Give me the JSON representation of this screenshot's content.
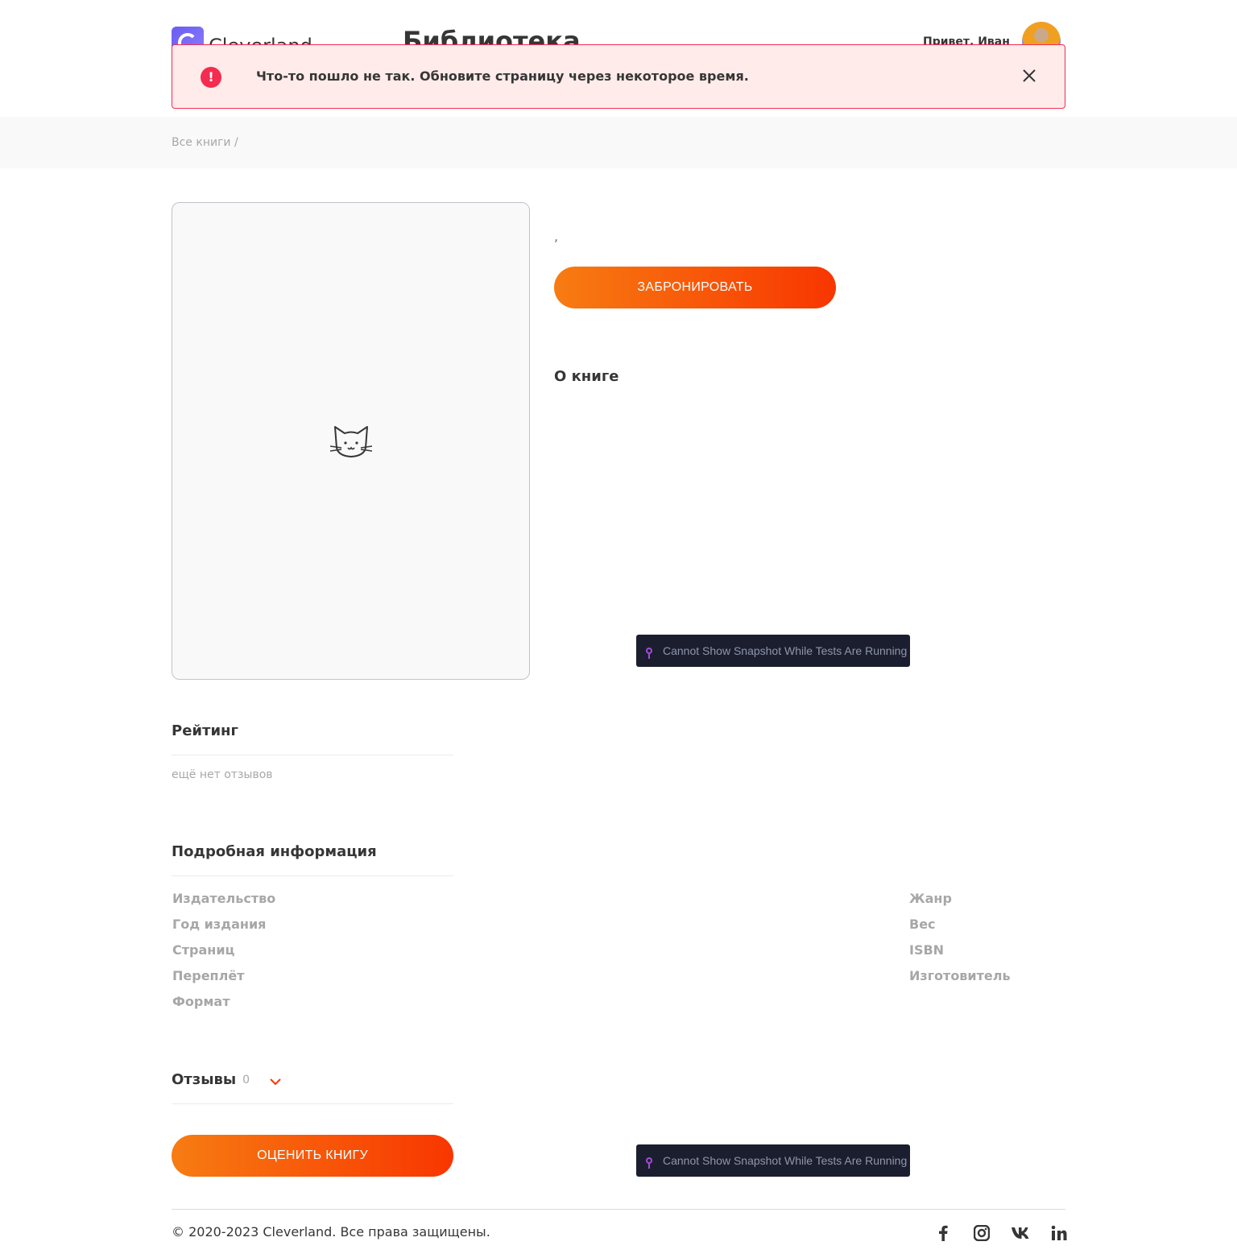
{
  "header": {
    "logo_text": "Cleverland",
    "page_title": "Библиотека",
    "greeting": "Привет, Иван"
  },
  "toast": {
    "icon_text": "!",
    "message": "Что-то пошло не так. Обновите страницу через некоторое время.",
    "status_color": "#f42c4f"
  },
  "breadcrumbs": {
    "text": "Все книги /"
  },
  "book": {
    "meta": ",",
    "reserve_label": "ЗАБРОНИРОВАТЬ",
    "about_title": "О книге"
  },
  "rating": {
    "title": "Рейтинг",
    "empty_text": "ещё нет отзывов"
  },
  "details": {
    "title": "Подробная информация",
    "left": [
      "Издательство",
      "Год издания",
      "Страниц",
      "Переплёт",
      "Формат"
    ],
    "right": [
      "Жанр",
      "Вес",
      "ISBN",
      "Изготовитель"
    ]
  },
  "reviews": {
    "title": "Отзывы",
    "count": "0",
    "rate_label": "ОЦЕНИТЬ КНИГУ"
  },
  "snapshot_note": {
    "text": "Cannot Show Snapshot While Tests Are Running"
  },
  "footer": {
    "copyright": "© 2020-2023 Cleverland. Все права защищены.",
    "social_icons": [
      "facebook-icon",
      "instagram-icon",
      "vk-icon",
      "linkedin-icon"
    ]
  },
  "colors": {
    "accent_start": "#f77c12",
    "accent_end": "#f83600",
    "error": "#f42c4f"
  }
}
